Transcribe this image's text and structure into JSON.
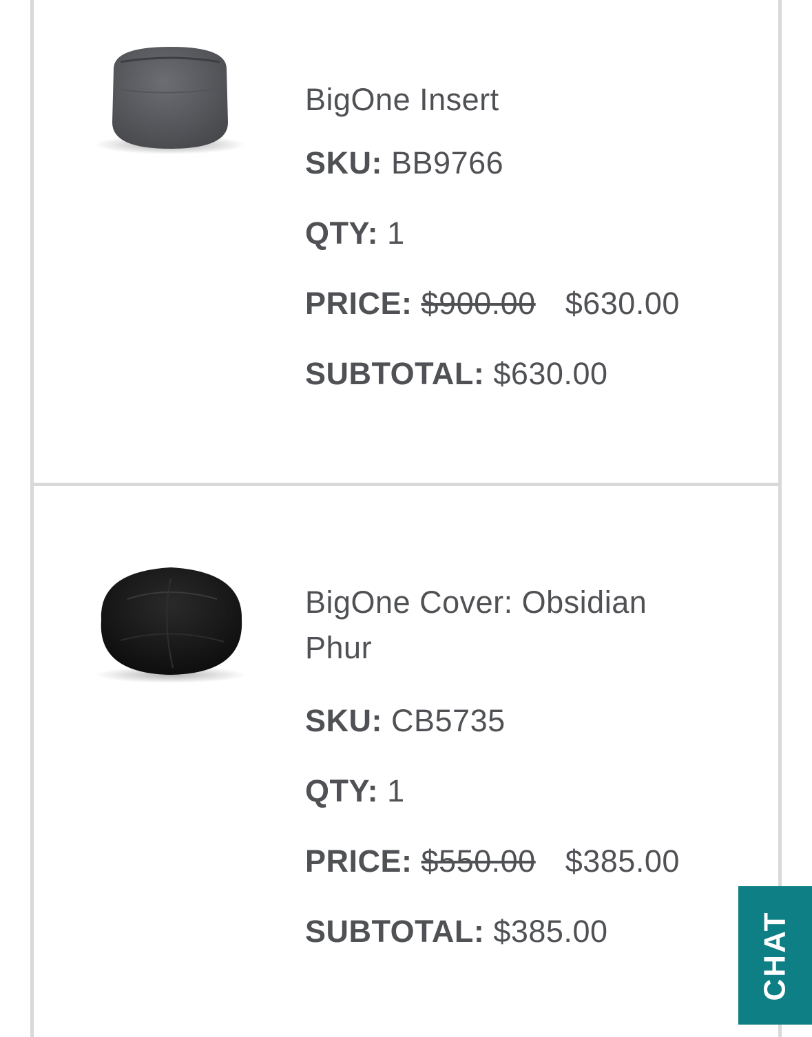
{
  "cart": {
    "items": [
      {
        "name": "BigOne Insert",
        "sku_label": "SKU:",
        "sku": "BB9766",
        "qty_label": "QTY:",
        "qty": "1",
        "price_label": "PRICE:",
        "original_price": "$900.00",
        "sale_price": "$630.00",
        "subtotal_label": "SUBTOTAL:",
        "subtotal": "$630.00",
        "image_color": "#5a5b60"
      },
      {
        "name": "BigOne Cover: Obsidian Phur",
        "sku_label": "SKU:",
        "sku": "CB5735",
        "qty_label": "QTY:",
        "qty": "1",
        "price_label": "PRICE:",
        "original_price": "$550.00",
        "sale_price": "$385.00",
        "subtotal_label": "SUBTOTAL:",
        "subtotal": "$385.00",
        "image_color": "#141414"
      }
    ]
  },
  "chat_button": {
    "label": "CHAT",
    "color": "#0e7f85"
  }
}
